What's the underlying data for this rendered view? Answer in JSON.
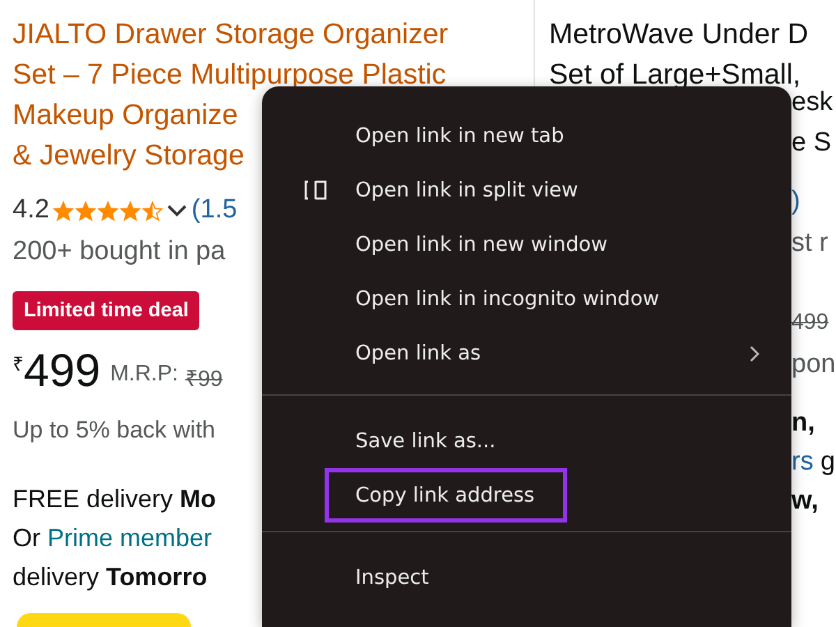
{
  "left_product": {
    "title_lines": [
      "JIALTO Drawer Storage Organizer",
      "Set – 7 Piece Multipurpose Plastic",
      "Makeup Organize",
      "& Jewelry Storage"
    ],
    "rating": "4.2",
    "stars": 4.5,
    "reviews": "(1.5",
    "bought": "200+ bought in pa",
    "deal_badge": "Limited time deal",
    "currency": "₹",
    "price": "499",
    "mrp_label": "M.R.P:",
    "mrp": "₹99",
    "cashback": "Up to 5% back with",
    "delivery": "FREE delivery **Mo**",
    "prime_prefix": "Or",
    "prime_link": "Prime member",
    "delivery_2": "delivery **Tomorro**"
  },
  "right_product": {
    "title_lines": [
      "MetroWave Under D",
      "Set of Large+Small,"
    ],
    "fragments": [
      {
        "parts": [
          {
            "text": "esk",
            "kind": "plain"
          }
        ]
      },
      {
        "parts": [
          {
            "text": "e S",
            "kind": "plain"
          }
        ]
      },
      {
        "parts": [
          {
            "text": ")",
            "kind": "link"
          }
        ]
      },
      {
        "parts": [
          {
            "text": "st r",
            "kind": "muted"
          }
        ]
      },
      {
        "parts": [
          {
            "text": "499",
            "kind": "struck"
          }
        ]
      },
      {
        "parts": [
          {
            "text": "pon",
            "kind": "muted"
          }
        ]
      },
      {
        "parts": [
          {
            "text": "n,",
            "kind": "bold"
          }
        ]
      },
      {
        "parts": [
          {
            "text": "rs",
            "kind": "link"
          },
          {
            "text": "g",
            "kind": "plain"
          }
        ]
      },
      {
        "parts": [
          {
            "text": "w,",
            "kind": "bold"
          }
        ]
      }
    ]
  },
  "context_menu": {
    "items": [
      {
        "kind": "item",
        "label": "Open link in new tab",
        "submenu": false,
        "highlighted": false
      },
      {
        "kind": "item",
        "label": "Open link in split view",
        "submenu": false,
        "highlighted": false
      },
      {
        "kind": "item",
        "label": "Open link in new window",
        "submenu": false,
        "highlighted": false
      },
      {
        "kind": "item",
        "label": "Open link in incognito window",
        "submenu": false,
        "highlighted": false
      },
      {
        "kind": "item",
        "label": "Open link as",
        "submenu": true,
        "highlighted": false
      },
      {
        "kind": "separator"
      },
      {
        "kind": "item",
        "label": "Save link as...",
        "submenu": false,
        "highlighted": false
      },
      {
        "kind": "item",
        "label": "Copy link address",
        "submenu": false,
        "highlighted": true
      },
      {
        "kind": "separator"
      },
      {
        "kind": "item",
        "label": "Inspect",
        "submenu": false,
        "highlighted": false
      }
    ]
  }
}
